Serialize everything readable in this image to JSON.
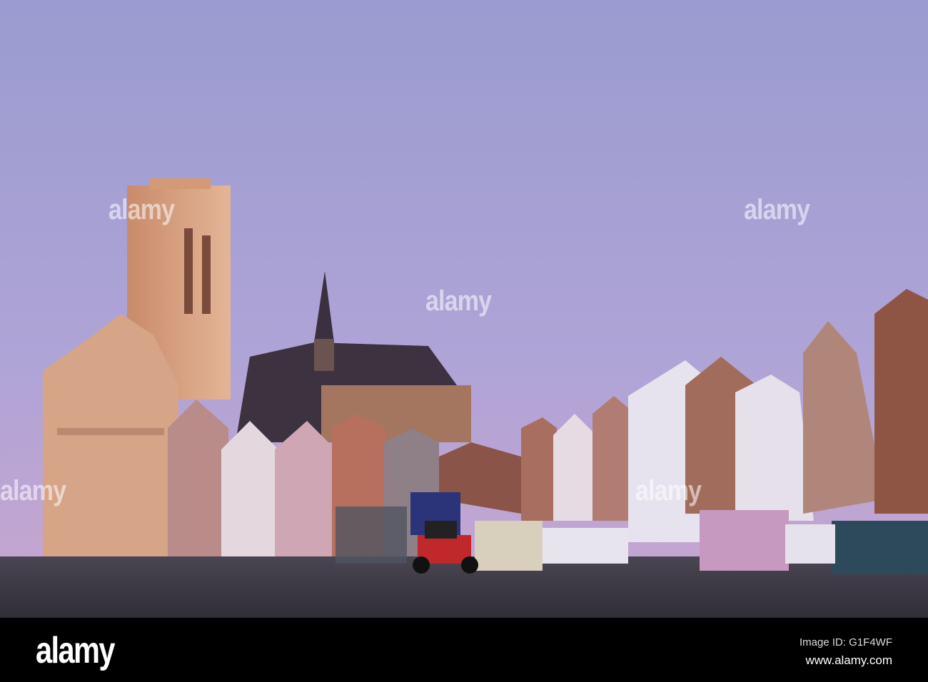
{
  "watermark": {
    "text": "alamy"
  },
  "footer": {
    "logo": "alamy",
    "image_id": "Image ID: G1F4WF",
    "website": "www.alamy.com"
  },
  "colors": {
    "sky_top": "#9a9bd0",
    "sky_bottom": "#c6a4cf",
    "ground": "#3a3842",
    "stone_lit": "#d9a78a"
  }
}
